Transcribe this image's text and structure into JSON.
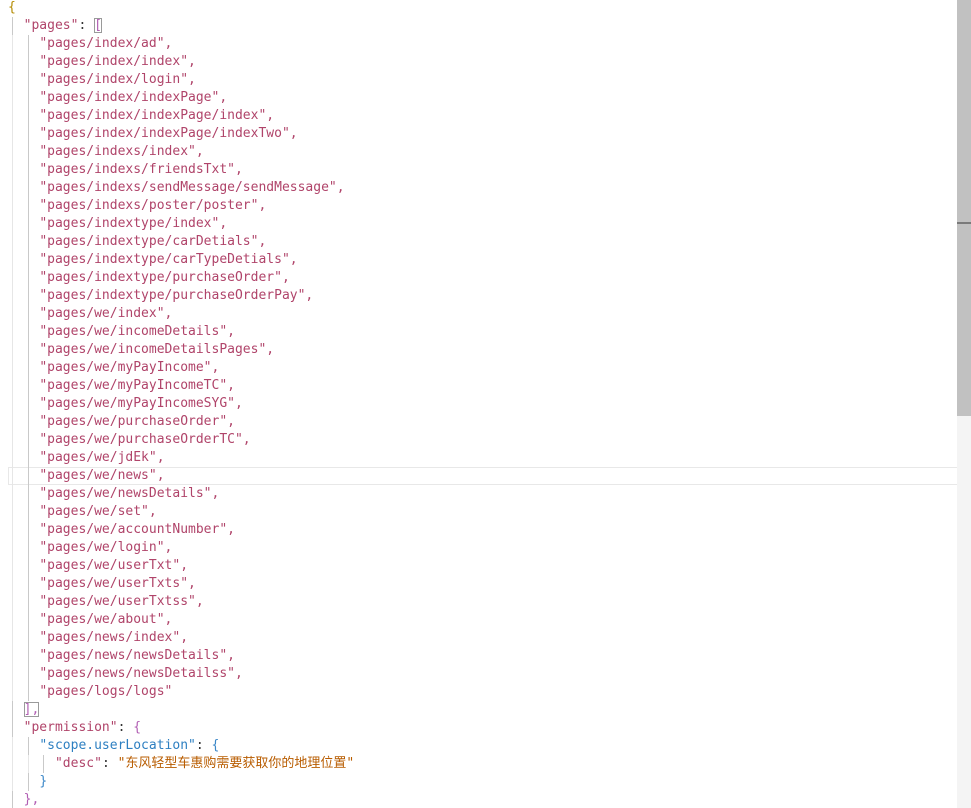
{
  "code": {
    "open_brace": "{",
    "pages_key": "\"pages\"",
    "pages_open": "[",
    "pages_close": "],",
    "pages": [
      "\"pages/index/ad\",",
      "\"pages/index/index\",",
      "\"pages/index/login\",",
      "\"pages/index/indexPage\",",
      "\"pages/index/indexPage/index\",",
      "\"pages/index/indexPage/indexTwo\",",
      "\"pages/indexs/index\",",
      "\"pages/indexs/friendsTxt\",",
      "\"pages/indexs/sendMessage/sendMessage\",",
      "\"pages/indexs/poster/poster\",",
      "\"pages/indextype/index\",",
      "\"pages/indextype/carDetials\",",
      "\"pages/indextype/carTypeDetials\",",
      "\"pages/indextype/purchaseOrder\",",
      "\"pages/indextype/purchaseOrderPay\",",
      "\"pages/we/index\",",
      "\"pages/we/incomeDetails\",",
      "\"pages/we/incomeDetailsPages\",",
      "\"pages/we/myPayIncome\",",
      "\"pages/we/myPayIncomeTC\",",
      "\"pages/we/myPayIncomeSYG\",",
      "\"pages/we/purchaseOrder\",",
      "\"pages/we/purchaseOrderTC\",",
      "\"pages/we/jdEk\",",
      "\"pages/we/news\",",
      "\"pages/we/newsDetails\",",
      "\"pages/we/set\",",
      "\"pages/we/accountNumber\",",
      "\"pages/we/login\",",
      "\"pages/we/userTxt\",",
      "\"pages/we/userTxts\",",
      "\"pages/we/userTxtss\",",
      "\"pages/we/about\",",
      "\"pages/news/index\",",
      "\"pages/news/newsDetails\",",
      "\"pages/news/newsDetailss\",",
      "\"pages/logs/logs\""
    ],
    "permission_key": "\"permission\"",
    "permission_open": "{",
    "scope_key": "\"scope.userLocation\"",
    "scope_open": "{",
    "desc_key": "\"desc\"",
    "desc_value": "\"东风轻型车惠购需要获取你的地理位置\"",
    "scope_close": "}",
    "permission_close": "},",
    "colon": ": "
  },
  "colors": {
    "string": "#b0446a",
    "bracket": "#b38a00",
    "accent": "#2d7fc1"
  }
}
